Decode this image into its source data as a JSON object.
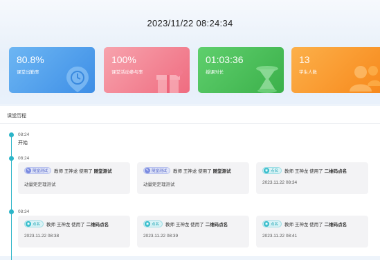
{
  "header": {
    "datetime": "2023/11/22 08:24:34"
  },
  "stats": [
    {
      "value": "80.8%",
      "label": "课堂出勤率",
      "icon": "clock-icon"
    },
    {
      "value": "100%",
      "label": "课堂活动参与率",
      "icon": "gift-box-icon"
    },
    {
      "value": "01:03:36",
      "label": "授课时长",
      "icon": "hourglass-icon"
    },
    {
      "value": "13",
      "label": "学生人数",
      "icon": "people-icon"
    }
  ],
  "colors": {
    "accent": "#2cb5c8",
    "blue": "#3d8ee6",
    "pink": "#ef6c80",
    "green": "#3bb04a",
    "orange": "#f7891c"
  },
  "history": {
    "title": "课堂历程",
    "groups": [
      {
        "time": "08:24",
        "text": "开始"
      },
      {
        "time": "08:24",
        "events": [
          {
            "badge": "随堂测试",
            "teacher": "教师 王神龙 使用了",
            "action": "随堂测试",
            "detail": "动量矩定理测试"
          },
          {
            "badge": "随堂测试",
            "teacher": "教师 王神龙 使用了",
            "action": "随堂测试",
            "detail": "动量矩定理测试"
          },
          {
            "badge": "点名",
            "teacher": "教师 王神龙 使用了",
            "action": "二维码点名",
            "detail": "2023.11.22 08:34"
          }
        ]
      },
      {
        "time": "08:34",
        "events": [
          {
            "badge": "点名",
            "teacher": "教师 王神龙 使用了",
            "action": "二维码点名",
            "detail": "2023.11.22 08:38"
          },
          {
            "badge": "点名",
            "teacher": "教师 王神龙 使用了",
            "action": "二维码点名",
            "detail": "2023.11.22 08:39"
          },
          {
            "badge": "点名",
            "teacher": "教师 王神龙 使用了",
            "action": "二维码点名",
            "detail": "2023.11.22 08:41"
          }
        ]
      }
    ]
  }
}
